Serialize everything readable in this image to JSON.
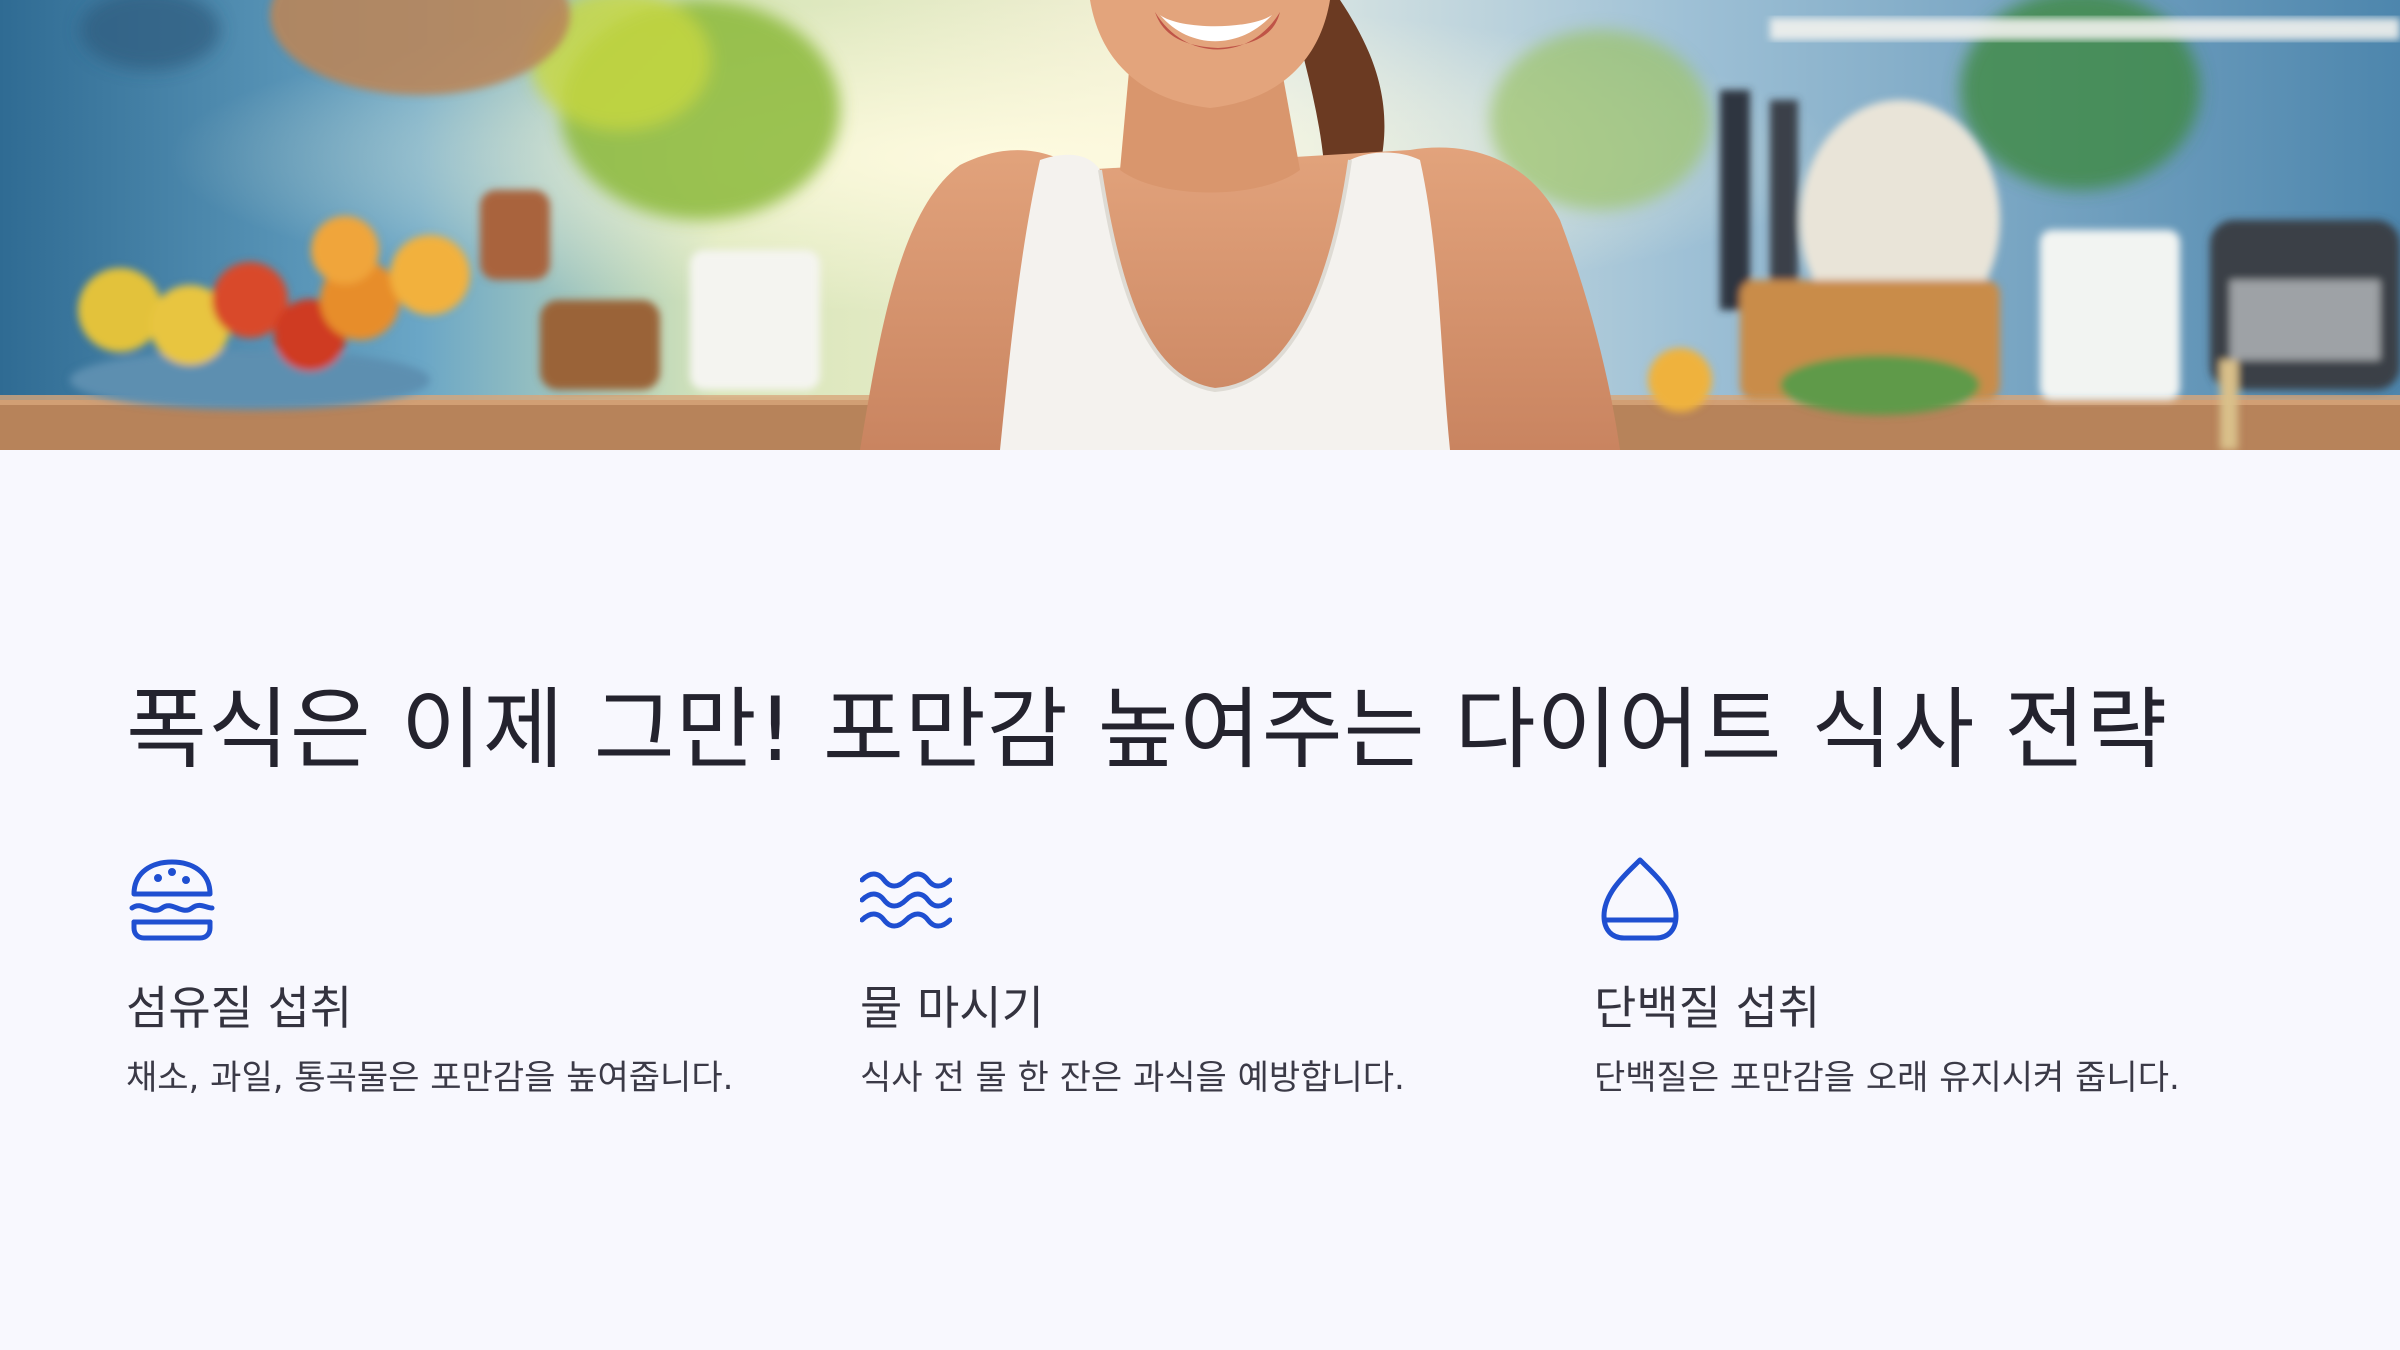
{
  "hero_image": {
    "description_icon": "photo-woman-smiling-kitchen"
  },
  "heading": {
    "title": "폭식은 이제 그만! 포만감 높여주는 다이어트 식사 전략"
  },
  "features": [
    {
      "icon": "burger-icon",
      "title": "섬유질 섭취",
      "description": "채소, 과일, 통곡물은 포만감을 높여줍니다."
    },
    {
      "icon": "water-waves-icon",
      "title": "물 마시기",
      "description": "식사 전 물 한 잔은 과식을 예방합니다."
    },
    {
      "icon": "drop-icon",
      "title": "단백질 섭취",
      "description": "단백질은 포만감을 오래 유지시켜 줍니다."
    }
  ],
  "colors": {
    "background": "#f8f8fe",
    "accent_icon": "#1f4fd1",
    "title_text": "#24232e"
  }
}
